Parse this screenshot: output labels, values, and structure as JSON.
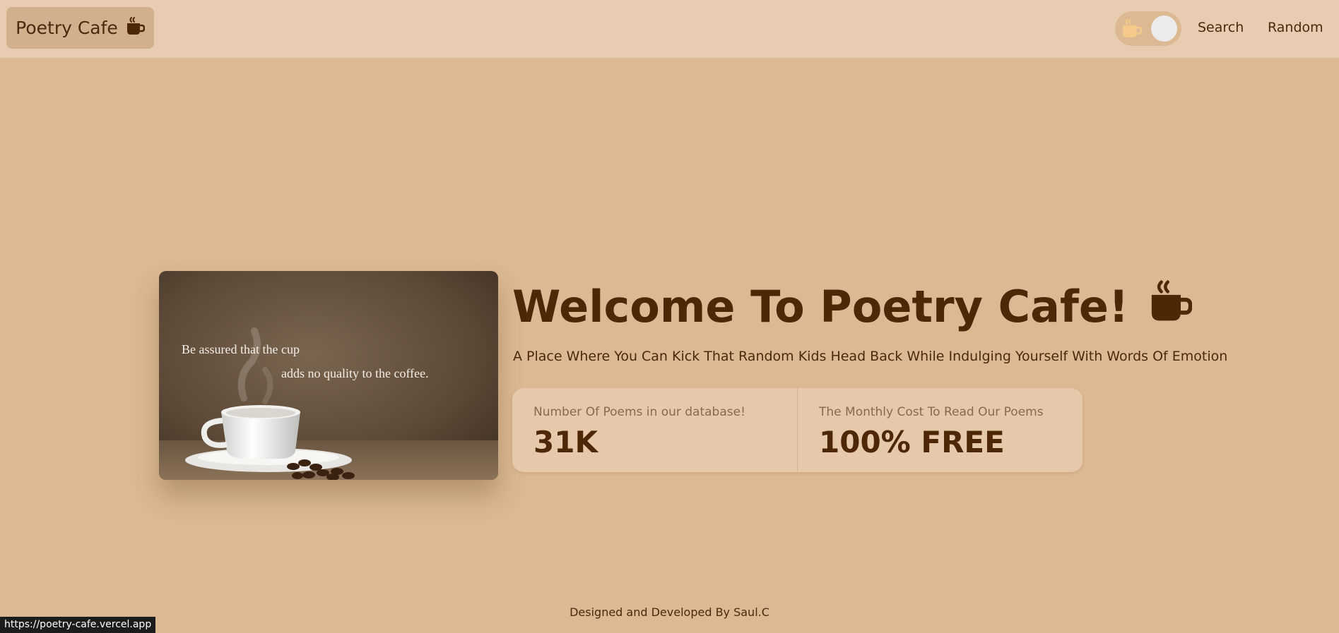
{
  "navbar": {
    "brand": "Poetry Cafe",
    "brand_icon": "coffee-icon",
    "theme_toggle_icon": "coffee-icon",
    "links": [
      "Search",
      "Random"
    ]
  },
  "hero": {
    "image_quote_line1": "Be assured that the cup",
    "image_quote_line2": "adds no quality to the coffee.",
    "title": "Welcome To Poetry Cafe!",
    "title_icon": "coffee-icon",
    "subtitle": "A Place Where You Can Kick That Random Kids Head Back While Indulging Yourself With Words Of Emotion"
  },
  "stats": [
    {
      "label": "Number Of Poems in our database!",
      "value": "31K"
    },
    {
      "label": "The Monthly Cost To Read Our Poems",
      "value": "100% FREE"
    }
  ],
  "footer": {
    "credit": "Designed and Developed By Saul.C"
  },
  "status_bar": {
    "url": "https://poetry-cafe.vercel.app"
  },
  "colors": {
    "navbar_bg": "#e8ccb2",
    "page_bg": "#dcb992",
    "brand_text": "#4e2706",
    "card_bg": "#e6c8aa"
  }
}
